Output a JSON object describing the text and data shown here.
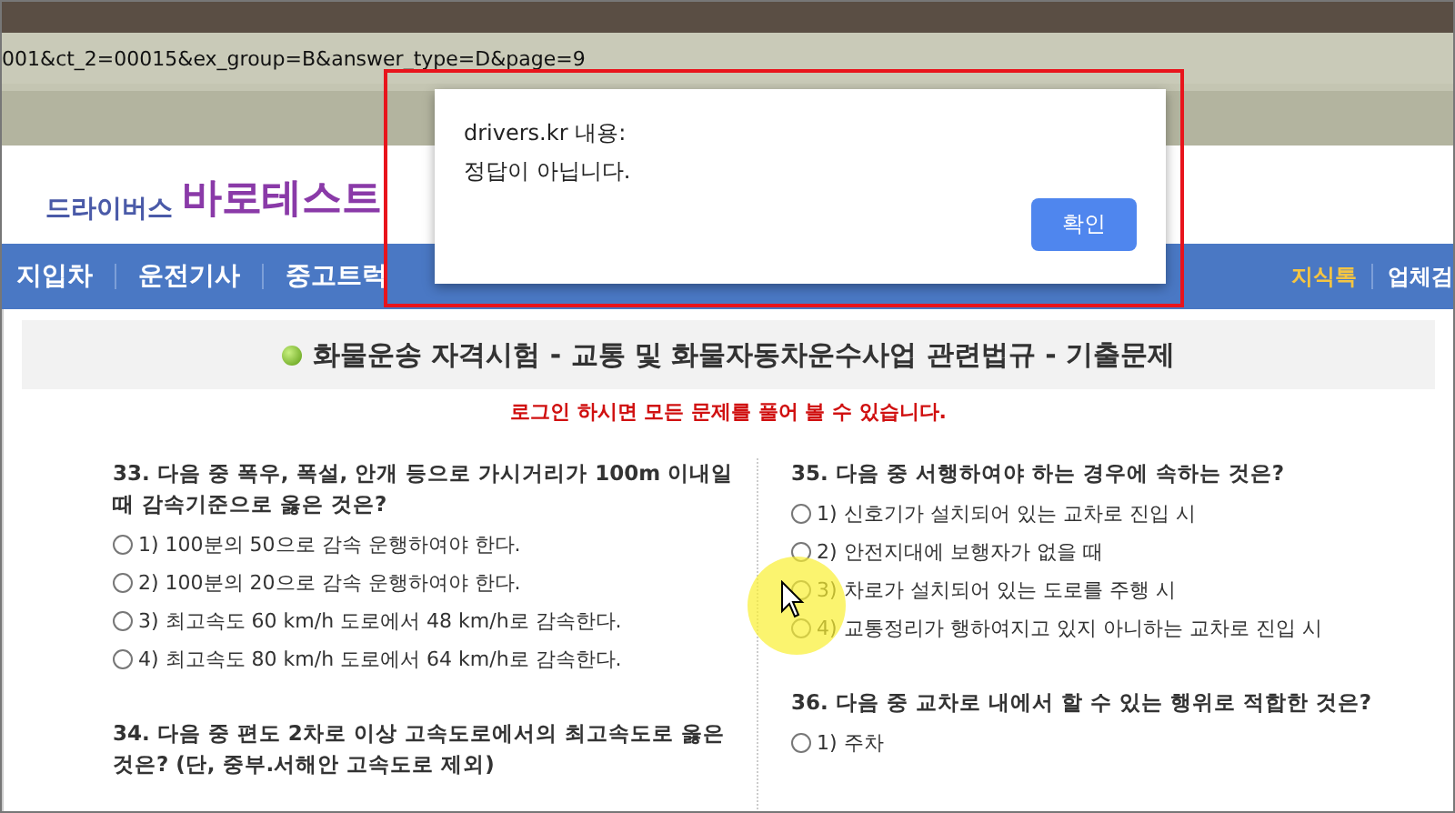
{
  "address_bar": {
    "url": "001&ct_2=00015&ex_group=B&answer_type=D&page=9"
  },
  "logo": {
    "small": "드라이버스",
    "large": "바로테스트"
  },
  "nav": {
    "left": [
      "지입차",
      "운전기사",
      "중고트럭"
    ],
    "right": [
      "지식톡",
      "업체검"
    ]
  },
  "exam": {
    "title": "화물운송 자격시험 - 교통 및 화물자동차운수사업 관련법규 - 기출문제",
    "notice": "로그인 하시면 모든 문제를 풀어 볼 수 있습니다.",
    "columns": [
      [
        {
          "question": "33. 다음 중 폭우, 폭설, 안개 등으로 가시거리가 100m 이내일 때 감속기준으로 옳은 것은?",
          "options": [
            {
              "text": "1) 100분의 50으로 감속 운행하여야 한다.",
              "selected": false
            },
            {
              "text": "2) 100분의 20으로 감속 운행하여야 한다.",
              "selected": false
            },
            {
              "text": "3) 최고속도 60 km/h 도로에서 48 km/h로 감속한다.",
              "selected": false
            },
            {
              "text": "4) 최고속도 80 km/h 도로에서 64 km/h로 감속한다.",
              "selected": false
            }
          ]
        },
        {
          "question": "34. 다음 중 편도 2차로 이상 고속도로에서의 최고속도로 옳은 것은? (단, 중부.서해안 고속도로 제외)"
        }
      ],
      [
        {
          "question": "35. 다음 중 서행하여야 하는 경우에 속하는 것은?",
          "options": [
            {
              "text": "1) 신호기가 설치되어 있는 교차로 진입 시",
              "selected": false
            },
            {
              "text": "2) 안전지대에 보행자가 없을 때",
              "selected": false
            },
            {
              "text": "3) 차로가 설치되어 있는 도로를 주행 시",
              "selected": false
            },
            {
              "text": "4) 교통정리가 행하여지고 있지 아니하는 교차로 진입 시",
              "selected": false
            }
          ]
        },
        {
          "question": "36. 다음 중 교차로 내에서 할 수 있는 행위로 적합한 것은?",
          "options": [
            {
              "text": "1) 주차",
              "selected": false
            }
          ]
        }
      ]
    ]
  },
  "dialog": {
    "origin": "drivers.kr 내용:",
    "message": "정답이 아닙니다.",
    "button": "확인"
  }
}
